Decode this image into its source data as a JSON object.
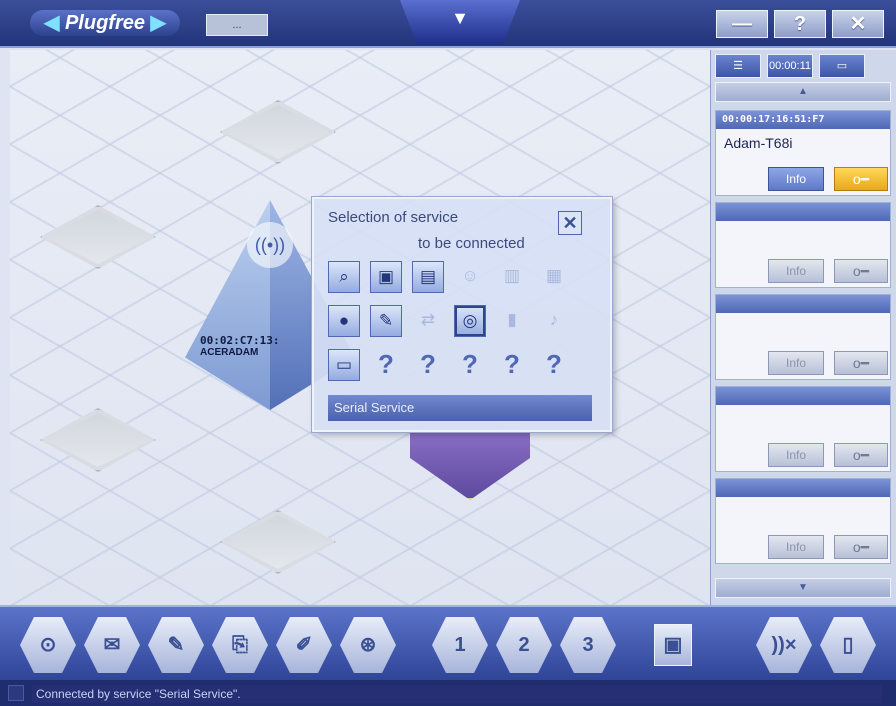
{
  "window": {
    "logo_text": "Plugfree",
    "logo_arrow": "▶",
    "logo_arrow_left": "◀",
    "mini_chip": "...",
    "center_tab_glyph": "▼",
    "minimize": "—",
    "help": "?",
    "close": "✕"
  },
  "canvas": {
    "device_mac": "00:02:C7:13:",
    "device_name": "ACERADAM",
    "device_icon": "((•))"
  },
  "dialog": {
    "title_line1": "Selection of service",
    "title_line2": "to be connected",
    "close_glyph": "✕",
    "selected_service": "Serial Service",
    "icons": {
      "r1c1": "⌕",
      "r1c2": "▣",
      "r1c3": "▤",
      "r1c4": "☺",
      "r1c5": "▥",
      "r1c6": "▦",
      "r2c1": "●",
      "r2c2": "✎",
      "r2c3": "⇄",
      "r2c4": "◎",
      "r2c5": "▮",
      "r2c6": "♪",
      "r3c1": "▭",
      "q": "?"
    }
  },
  "rightpanel": {
    "view_btn_list": "☰",
    "view_btn_addr": "00:00:11",
    "view_btn_screen": "▭",
    "scroll_up": "▲",
    "scroll_down": "▼",
    "slot1_mac": "00:00:17:16:51:F7",
    "slot1_name": "Adam-T68i",
    "info_label": "Info",
    "key_glyph": "o━"
  },
  "toolbar": {
    "t1": "⊙",
    "t2": "✉",
    "t3": "✎",
    "t4": "⎘",
    "t5": "✐",
    "t6": "⊛",
    "n1": "1",
    "n2": "2",
    "n3": "3",
    "t10": "▣",
    "t11": "))×",
    "t12": "▯"
  },
  "status": {
    "message": "Connected by service \"Serial Service\"."
  }
}
